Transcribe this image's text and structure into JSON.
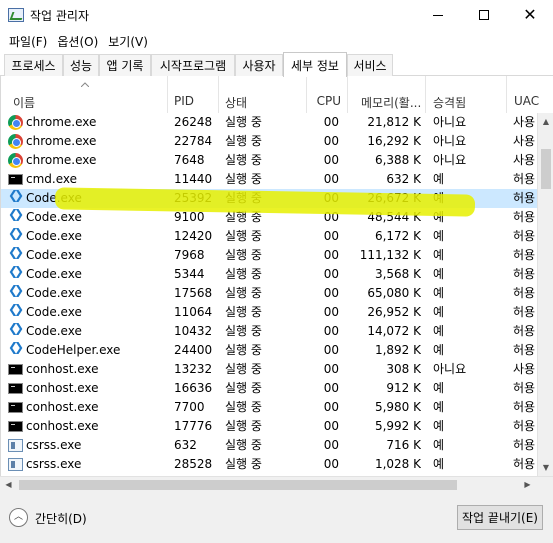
{
  "window": {
    "title": "작업 관리자",
    "minimize": "",
    "maximize": "",
    "close": "✕"
  },
  "menu": [
    "파일(F)",
    "옵션(O)",
    "보기(V)"
  ],
  "tabs": [
    "프로세스",
    "성능",
    "앱 기록",
    "시작프로그램",
    "사용자",
    "세부 정보",
    "서비스"
  ],
  "active_tab": "세부 정보",
  "columns": {
    "name": "이름",
    "pid": "PID",
    "status": "상태",
    "username": "",
    "cpu": "CPU",
    "memory": "메모리(활...",
    "elevated": "승격됨",
    "uac": "UAC"
  },
  "rows": [
    {
      "icon": "chrome-icon",
      "name": "chrome.exe",
      "pid": "26248",
      "status": "실행 중",
      "cpu": "00",
      "memory": "21,812 K",
      "elevated": "아니요",
      "uac": "사용"
    },
    {
      "icon": "chrome-icon",
      "name": "chrome.exe",
      "pid": "22784",
      "status": "실행 중",
      "cpu": "00",
      "memory": "16,292 K",
      "elevated": "아니요",
      "uac": "사용"
    },
    {
      "icon": "chrome-icon",
      "name": "chrome.exe",
      "pid": "7648",
      "status": "실행 중",
      "cpu": "00",
      "memory": "6,388 K",
      "elevated": "아니요",
      "uac": "사용"
    },
    {
      "icon": "cmd-icon",
      "name": "cmd.exe",
      "pid": "11440",
      "status": "실행 중",
      "cpu": "00",
      "memory": "632 K",
      "elevated": "예",
      "uac": "허용"
    },
    {
      "icon": "vscode-icon",
      "name": "Code.exe",
      "pid": "25392",
      "status": "실행 중",
      "cpu": "00",
      "memory": "26,672 K",
      "elevated": "예",
      "uac": "허용",
      "selected": true
    },
    {
      "icon": "vscode-icon",
      "name": "Code.exe",
      "pid": "9100",
      "status": "실행 중",
      "cpu": "00",
      "memory": "48,544 K",
      "elevated": "예",
      "uac": "허용"
    },
    {
      "icon": "vscode-icon",
      "name": "Code.exe",
      "pid": "12420",
      "status": "실행 중",
      "cpu": "00",
      "memory": "6,172 K",
      "elevated": "예",
      "uac": "허용"
    },
    {
      "icon": "vscode-icon",
      "name": "Code.exe",
      "pid": "7968",
      "status": "실행 중",
      "cpu": "00",
      "memory": "111,132 K",
      "elevated": "예",
      "uac": "허용"
    },
    {
      "icon": "vscode-icon",
      "name": "Code.exe",
      "pid": "5344",
      "status": "실행 중",
      "cpu": "00",
      "memory": "3,568 K",
      "elevated": "예",
      "uac": "허용"
    },
    {
      "icon": "vscode-icon",
      "name": "Code.exe",
      "pid": "17568",
      "status": "실행 중",
      "cpu": "00",
      "memory": "65,080 K",
      "elevated": "예",
      "uac": "허용"
    },
    {
      "icon": "vscode-icon",
      "name": "Code.exe",
      "pid": "11064",
      "status": "실행 중",
      "cpu": "00",
      "memory": "26,952 K",
      "elevated": "예",
      "uac": "허용"
    },
    {
      "icon": "vscode-icon",
      "name": "Code.exe",
      "pid": "10432",
      "status": "실행 중",
      "cpu": "00",
      "memory": "14,072 K",
      "elevated": "예",
      "uac": "허용"
    },
    {
      "icon": "vscode-icon",
      "name": "CodeHelper.exe",
      "pid": "24400",
      "status": "실행 중",
      "cpu": "00",
      "memory": "1,892 K",
      "elevated": "예",
      "uac": "허용"
    },
    {
      "icon": "cmd-icon",
      "name": "conhost.exe",
      "pid": "13232",
      "status": "실행 중",
      "cpu": "00",
      "memory": "308 K",
      "elevated": "아니요",
      "uac": "사용"
    },
    {
      "icon": "cmd-icon",
      "name": "conhost.exe",
      "pid": "16636",
      "status": "실행 중",
      "cpu": "00",
      "memory": "912 K",
      "elevated": "예",
      "uac": "허용"
    },
    {
      "icon": "cmd-icon",
      "name": "conhost.exe",
      "pid": "7700",
      "status": "실행 중",
      "cpu": "00",
      "memory": "5,980 K",
      "elevated": "예",
      "uac": "허용"
    },
    {
      "icon": "cmd-icon",
      "name": "conhost.exe",
      "pid": "17776",
      "status": "실행 중",
      "cpu": "00",
      "memory": "5,992 K",
      "elevated": "예",
      "uac": "허용"
    },
    {
      "icon": "csrss-icon",
      "name": "csrss.exe",
      "pid": "632",
      "status": "실행 중",
      "cpu": "00",
      "memory": "716 K",
      "elevated": "예",
      "uac": "허용"
    },
    {
      "icon": "csrss-icon",
      "name": "csrss.exe",
      "pid": "28528",
      "status": "실행 중",
      "cpu": "00",
      "memory": "1,028 K",
      "elevated": "예",
      "uac": "허용"
    }
  ],
  "footer": {
    "fewer_details": "간단히(D)",
    "end_task": "작업 끝내기(E)"
  },
  "colors": {
    "selection": "#cce8ff",
    "highlighter": "#e6f000",
    "vscode_blue": "#1f7acb"
  }
}
